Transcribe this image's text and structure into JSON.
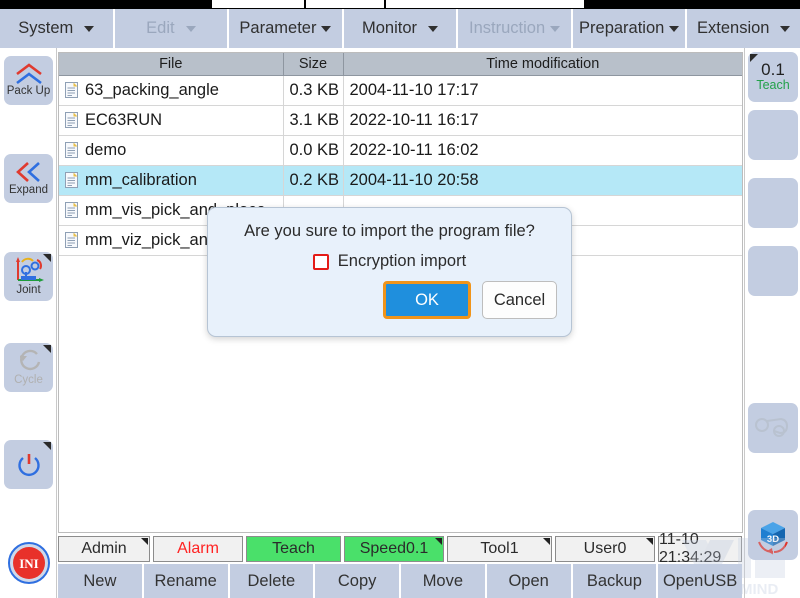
{
  "menubar": {
    "items": [
      {
        "label": "System",
        "enabled": true,
        "icon": "chevron-down-icon"
      },
      {
        "label": "Edit",
        "enabled": false,
        "icon": "chevron-down-icon"
      },
      {
        "label": "Parameter",
        "enabled": true,
        "icon": "chevron-down-icon"
      },
      {
        "label": "Monitor",
        "enabled": true,
        "icon": "chevron-down-icon"
      },
      {
        "label": "Instruction",
        "enabled": false,
        "icon": "chevron-down-icon"
      },
      {
        "label": "Preparation",
        "enabled": true,
        "icon": "chevron-down-icon"
      },
      {
        "label": "Extension",
        "enabled": true,
        "icon": "chevron-down-icon"
      }
    ]
  },
  "left_rail": {
    "items": [
      {
        "label": "Pack Up",
        "icon": "chevron-up-double-icon",
        "enabled": true,
        "marker": false
      },
      {
        "label": "Expand",
        "icon": "chevron-left-double-icon",
        "enabled": true,
        "marker": false
      },
      {
        "label": "Joint",
        "icon": "robot-joint-icon",
        "enabled": true,
        "marker": true
      },
      {
        "label": "Cycle",
        "icon": "cycle-icon",
        "enabled": false,
        "marker": true
      },
      {
        "label": "",
        "icon": "power-icon",
        "enabled": true,
        "marker": true
      },
      {
        "label": "",
        "icon": "ini-icon",
        "enabled": true,
        "marker": false
      }
    ],
    "ini_text": "INI"
  },
  "right_rail": {
    "speed_value": "0.1",
    "speed_mode": "Teach",
    "items": [
      {
        "icon": "speed-teach-icon",
        "marker": true
      },
      {
        "icon": "blank-icon",
        "marker": false
      },
      {
        "icon": "blank-icon",
        "marker": false
      },
      {
        "icon": "blank-icon",
        "marker": false
      },
      {
        "icon": "drag-teach-icon",
        "marker": false
      },
      {
        "icon": "three-d-view-icon",
        "marker": false
      }
    ]
  },
  "file_table": {
    "columns": [
      "File",
      "Size",
      "Time modification"
    ],
    "rows": [
      {
        "file": "63_packing_angle",
        "size": "0.3 KB",
        "time": "2004-11-10 17:17",
        "selected": false
      },
      {
        "file": "EC63RUN",
        "size": "3.1 KB",
        "time": "2022-10-11 16:17",
        "selected": false
      },
      {
        "file": "demo",
        "size": "0.0 KB",
        "time": "2022-10-11 16:02",
        "selected": false
      },
      {
        "file": "mm_calibration",
        "size": "0.2 KB",
        "time": "2004-11-10 20:58",
        "selected": true
      },
      {
        "file": "mm_vis_pick_and_place",
        "size": "",
        "time": "",
        "selected": false
      },
      {
        "file": "mm_viz_pick_and_place",
        "size": "",
        "time": "",
        "selected": false
      }
    ]
  },
  "dialog": {
    "message": "Are you sure to import the program file?",
    "checkbox_label": "Encryption import",
    "checkbox_checked": false,
    "ok_label": "OK",
    "cancel_label": "Cancel"
  },
  "statusbar": {
    "cells": [
      {
        "label": "Admin",
        "style": "normal",
        "marker": true
      },
      {
        "label": "Alarm",
        "style": "alarm",
        "marker": false
      },
      {
        "label": "Teach",
        "style": "green",
        "marker": false
      },
      {
        "label": "Speed0.1",
        "style": "green",
        "marker": true
      },
      {
        "label": "Tool1",
        "style": "normal",
        "marker": true
      },
      {
        "label": "User0",
        "style": "normal",
        "marker": true
      },
      {
        "label": "11-10 21:34:29",
        "style": "normal",
        "marker": false
      }
    ]
  },
  "bottombar": {
    "buttons": [
      "New",
      "Rename",
      "Delete",
      "Copy",
      "Move",
      "Open",
      "Backup",
      "OpenUSB"
    ]
  },
  "colors": {
    "menu_bg": "#c3cde1",
    "header_bg": "#b8c0ca",
    "selected_row": "#b5e8f7",
    "dialog_bg": "#e8f1fb",
    "ok_button": "#1f8fdd",
    "focus_ring": "#f0941a",
    "checkbox_border": "#e41b17",
    "alarm_text": "#ff2222",
    "green_status": "#4ae06a",
    "teach_green": "#22a14a"
  }
}
